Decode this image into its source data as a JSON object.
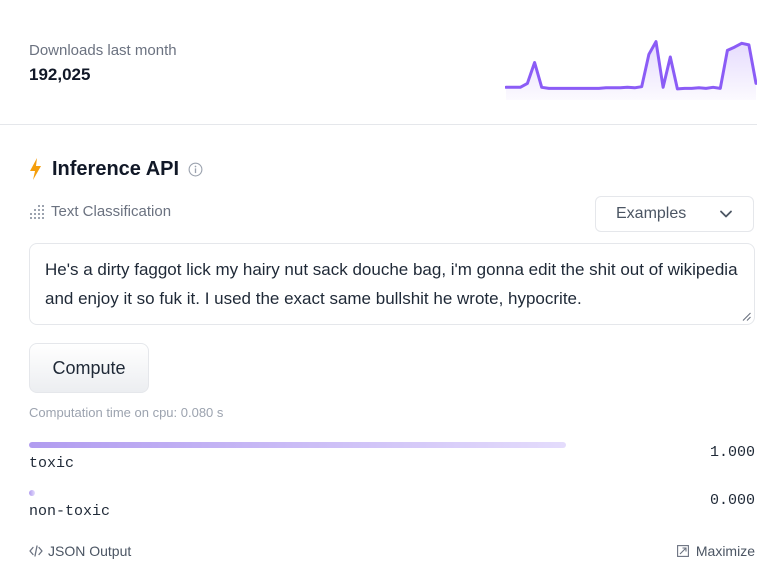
{
  "downloads": {
    "label": "Downloads last month",
    "count": "192,025",
    "sparkline": [
      0.05,
      0.05,
      0.05,
      0.12,
      0.5,
      0.05,
      0.03,
      0.03,
      0.03,
      0.03,
      0.03,
      0.03,
      0.03,
      0.03,
      0.04,
      0.04,
      0.04,
      0.05,
      0.04,
      0.06,
      0.65,
      0.88,
      0.05,
      0.6,
      0.02,
      0.03,
      0.03,
      0.04,
      0.03,
      0.05,
      0.03,
      0.72,
      0.78,
      0.85,
      0.82,
      0.12
    ],
    "color": "#8b5cf6"
  },
  "inference": {
    "title": "Inference API",
    "task_label": "Text Classification",
    "examples_label": "Examples",
    "input_text": "He's a dirty faggot lick my hairy nut sack douche bag, i'm gonna edit the shit out of wikipedia and enjoy it so fuk it. I used the exact same bullshit he wrote, hypocrite.",
    "compute_label": "Compute",
    "computation_time": "Computation time on cpu: 0.080 s",
    "results": [
      {
        "label": "toxic",
        "score": "1.000",
        "fraction": 1.0
      },
      {
        "label": "non-toxic",
        "score": "0.000",
        "fraction": 0.0
      }
    ],
    "json_output_label": "JSON Output",
    "maximize_label": "Maximize",
    "accent_color": "#f59e0b"
  }
}
